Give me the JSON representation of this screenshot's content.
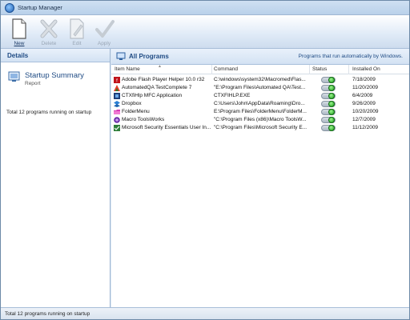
{
  "window": {
    "title": "Startup Manager"
  },
  "toolbar": {
    "buttons": [
      {
        "label": "New",
        "icon": "new-document-icon",
        "enabled": true
      },
      {
        "label": "Delete",
        "icon": "delete-x-icon",
        "enabled": false
      },
      {
        "label": "Edit",
        "icon": "edit-document-icon",
        "enabled": false
      },
      {
        "label": "Apply",
        "icon": "checkmark-icon",
        "enabled": false
      }
    ]
  },
  "left_pane": {
    "header": "Details",
    "summary_title": "Startup Summary",
    "summary_subtitle": "Report",
    "total_text": "Total 12 programs running on startup"
  },
  "right_pane": {
    "header": "All Programs",
    "note": "Programs that run automatically by Windows.",
    "columns": [
      "Item Name",
      "Command",
      "Status",
      "Installed On"
    ],
    "rows": [
      {
        "name": "Adobe Flash Player Helper 10.0 r32",
        "command": "C:\\windows\\system32\\Macromed\\Flas...",
        "status": "on",
        "installed": "7/18/2009",
        "icon": "flash-icon"
      },
      {
        "name": "AutomatedQA TestComplete 7",
        "command": "\"E:\\Program Files\\Automated QA\\Test...",
        "status": "on",
        "installed": "11/20/2009",
        "icon": "testcomplete-icon"
      },
      {
        "name": "CTXfiHlp MFC Application",
        "command": "CTXFIHLP.EXE",
        "status": "on",
        "installed": "6/4/2009",
        "icon": "app-icon"
      },
      {
        "name": "Dropbox",
        "command": "C:\\Users\\John\\AppData\\Roaming\\Dro...",
        "status": "on",
        "installed": "9/26/2009",
        "icon": "dropbox-icon"
      },
      {
        "name": "FolderMenu",
        "command": "E:\\Program Files\\FolderMenu\\FolderM...",
        "status": "on",
        "installed": "10/20/2009",
        "icon": "folder-icon"
      },
      {
        "name": "Macro ToolsWorks",
        "command": "\"C:\\Program Files (x86)\\Macro ToolsW...",
        "status": "on",
        "installed": "12/7/2009",
        "icon": "macro-icon"
      },
      {
        "name": "Microsoft Security Essentials User In...",
        "command": "\"C:\\Program Files\\Microsoft Security E...",
        "status": "on",
        "installed": "11/12/2009",
        "icon": "security-icon"
      }
    ]
  },
  "statusbar": {
    "text": "Total 12 programs running on startup"
  },
  "colors": {
    "accent": "#1f4b84",
    "toggle_on": "#1a9b1a"
  }
}
